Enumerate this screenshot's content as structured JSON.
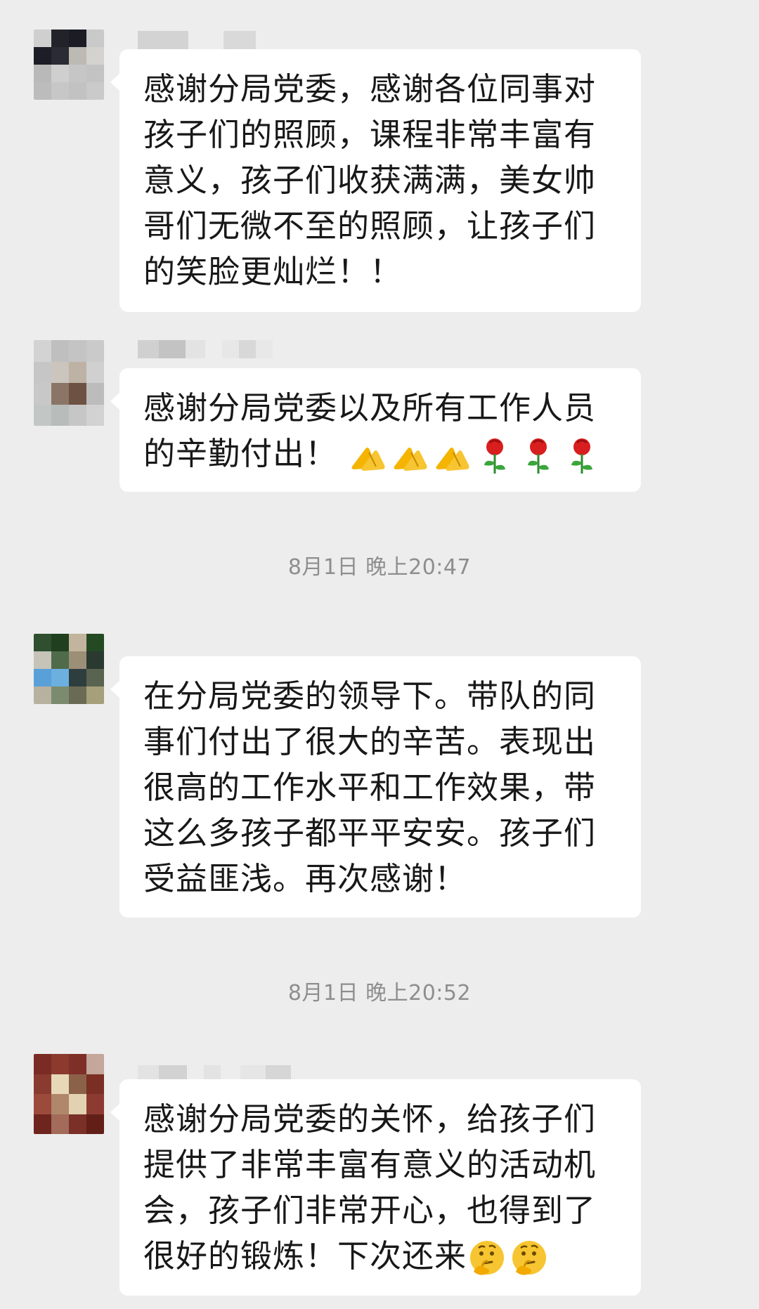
{
  "messages": [
    {
      "text": "感谢分局党委，感谢各位同事对孩子们的照顾，课程非常丰富有意义，孩子们收获满满，美女帅哥们无微不至的照顾，让孩子们的笑脸更灿烂！！"
    },
    {
      "text": "感谢分局党委以及所有工作人员的辛勤付出！",
      "emojis": [
        "folded-hands",
        "folded-hands",
        "folded-hands",
        "rose",
        "rose",
        "rose"
      ]
    },
    {
      "text": "在分局党委的领导下。带队的同事们付出了很大的辛苦。表现出很高的工作水平和工作效果，带这么多孩子都平平安安。孩子们受益匪浅。再次感谢！"
    },
    {
      "text": "感谢分局党委的关怀，给孩子们提供了非常丰富有意义的活动机会，孩子们非常开心，也得到了很好的锻炼！下次还来",
      "emojis": [
        "thinking-face",
        "thinking-face"
      ]
    }
  ],
  "timestamps": [
    "8月1日 晚上20:47",
    "8月1日 晚上20:52"
  ],
  "colors": {
    "background": "#ededed",
    "bubble": "#ffffff",
    "text": "#181818",
    "timestamp": "#8e8e8e"
  }
}
